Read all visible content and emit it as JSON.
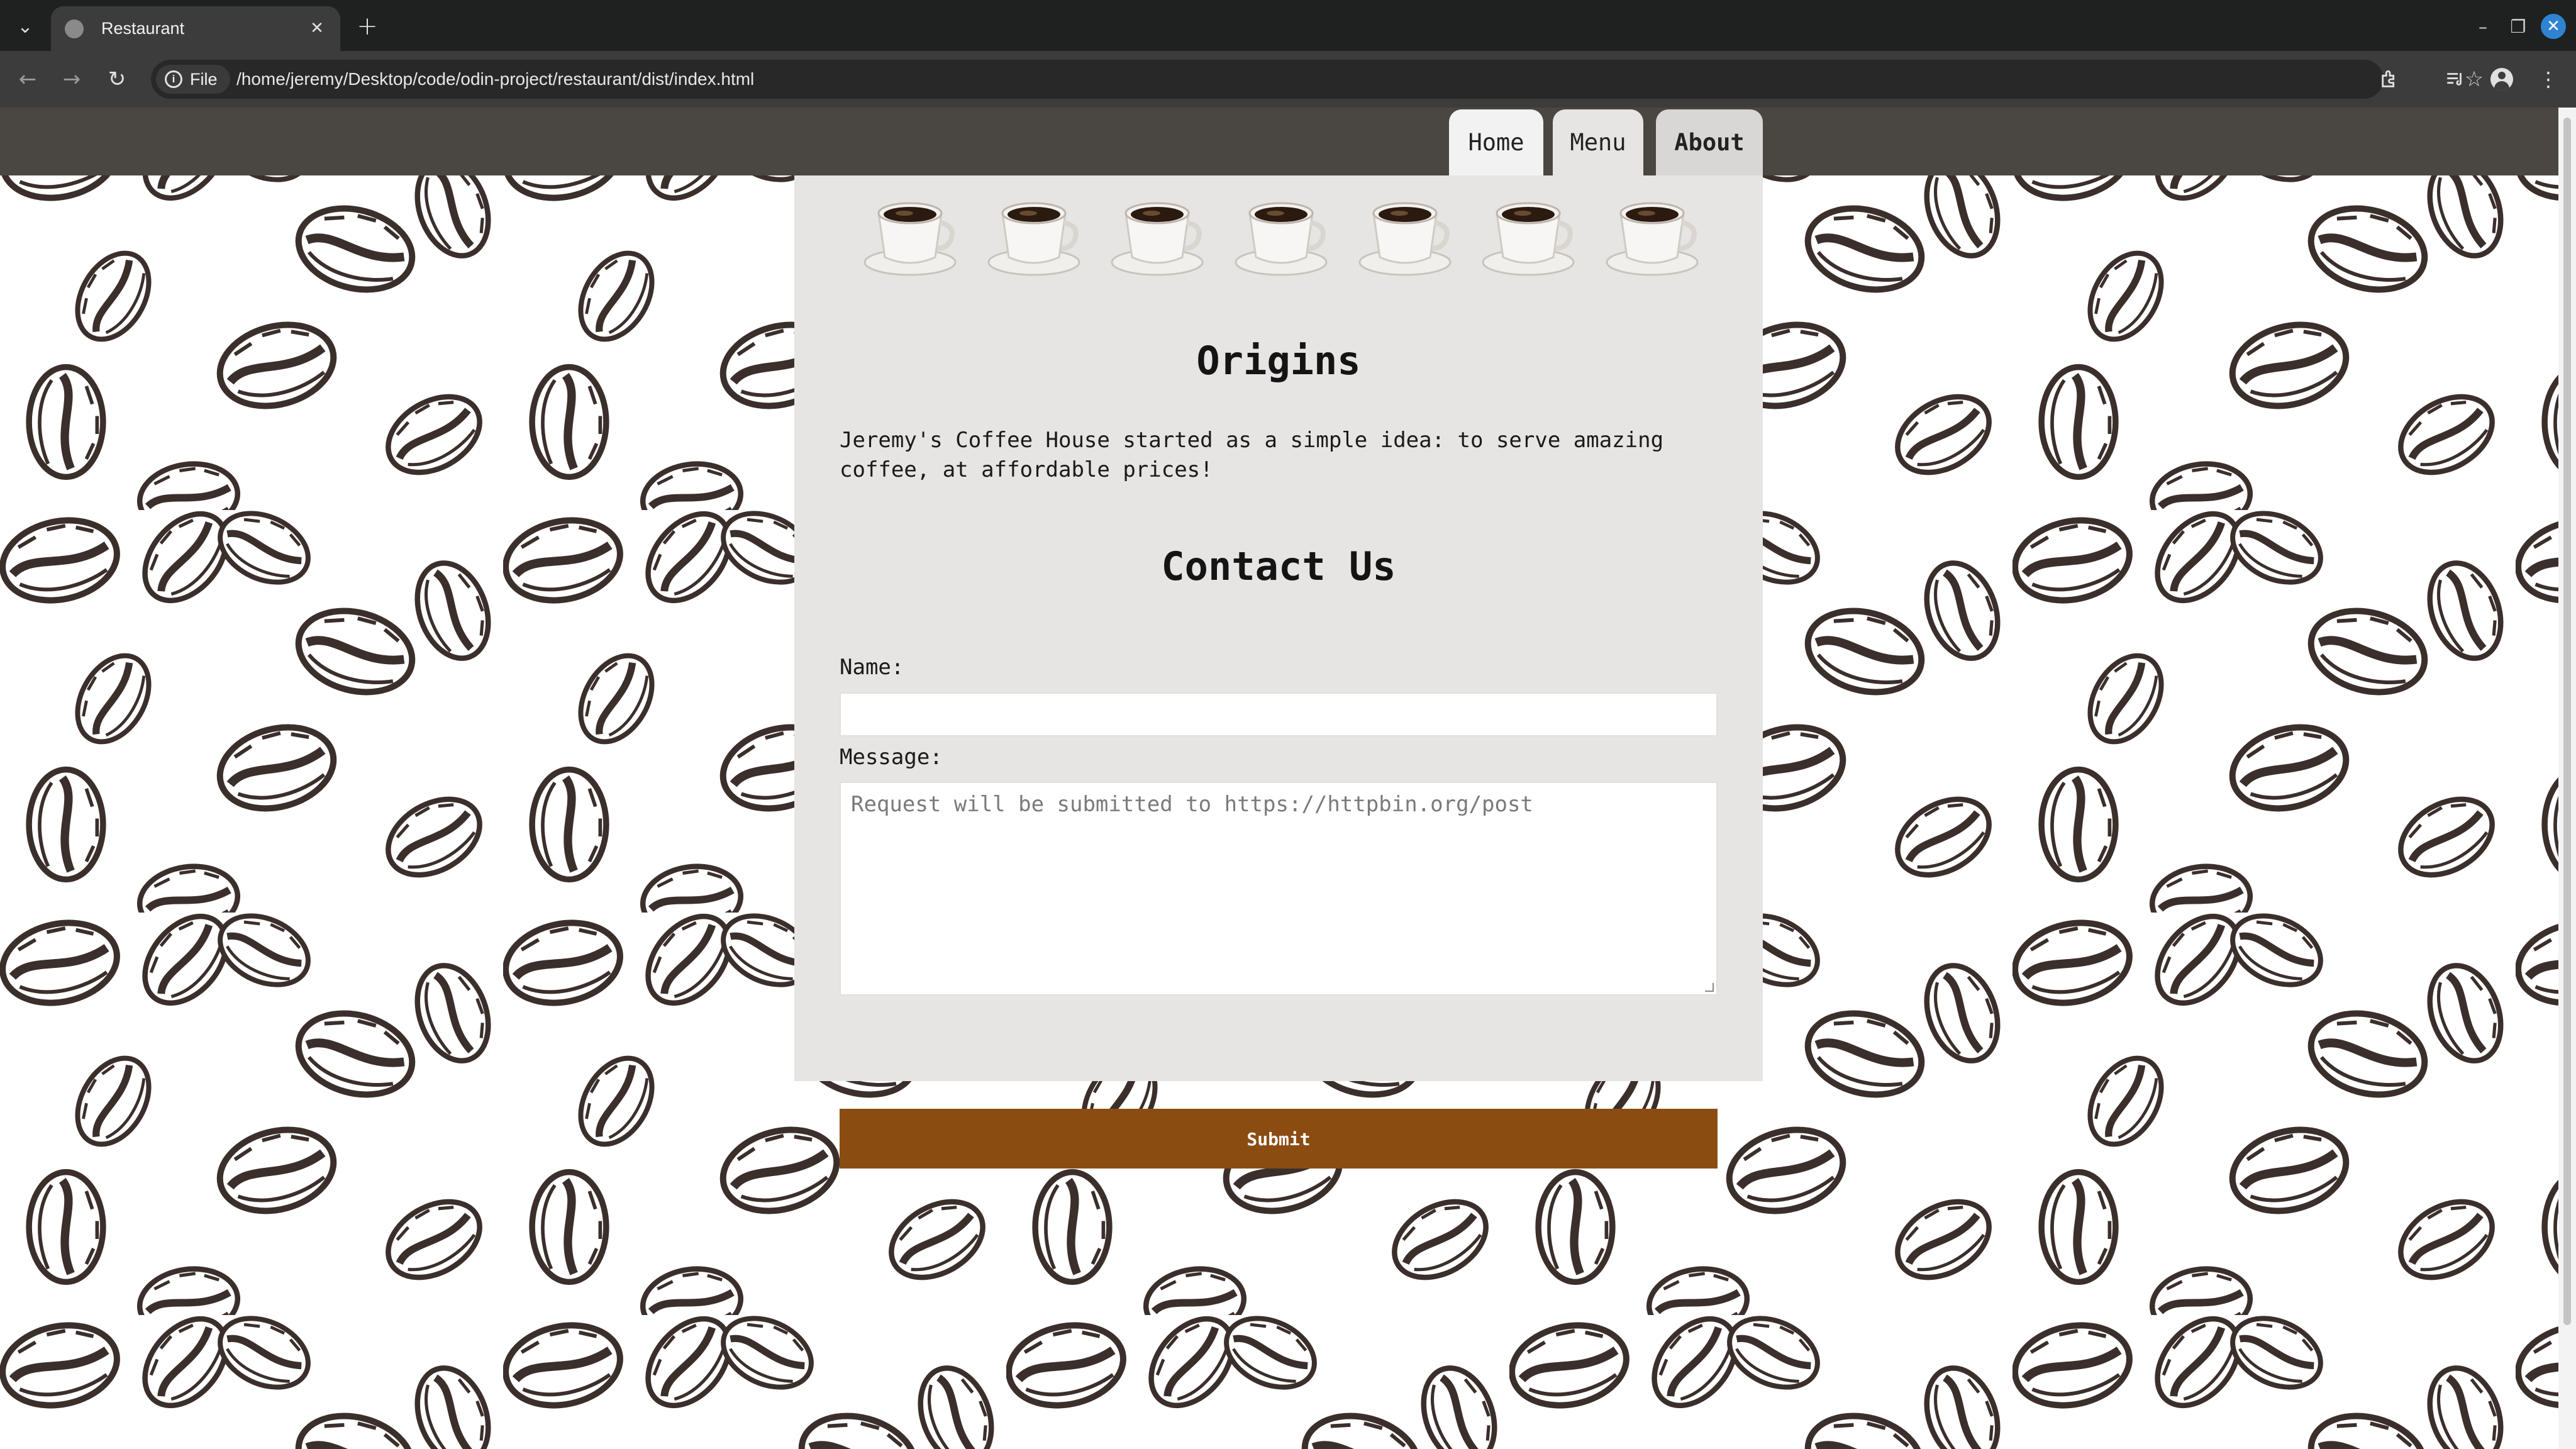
{
  "browser": {
    "tab_title": "Restaurant",
    "url": "/home/jeremy/Desktop/code/odin-project/restaurant/dist/index.html",
    "site_info_label": "File"
  },
  "site": {
    "nav": {
      "home": "Home",
      "menu": "Menu",
      "about": "About",
      "active": "About"
    },
    "cup_count": 7,
    "origins": {
      "heading": "Origins",
      "text": "Jeremy's Coffee House started as a simple idea: to serve amazing coffee, at affordable prices!"
    },
    "contact": {
      "heading": "Contact Us",
      "name_label": "Name:",
      "name_value": "",
      "message_label": "Message:",
      "message_placeholder": "Request will be submitted to https://httpbin.org/post",
      "submit_label": "Submit"
    }
  },
  "colors": {
    "header_bg": "#4a4642",
    "panel_bg": "#e6e5e4",
    "submit_bg": "#8b4c12",
    "bean": "#3b2f2c"
  }
}
